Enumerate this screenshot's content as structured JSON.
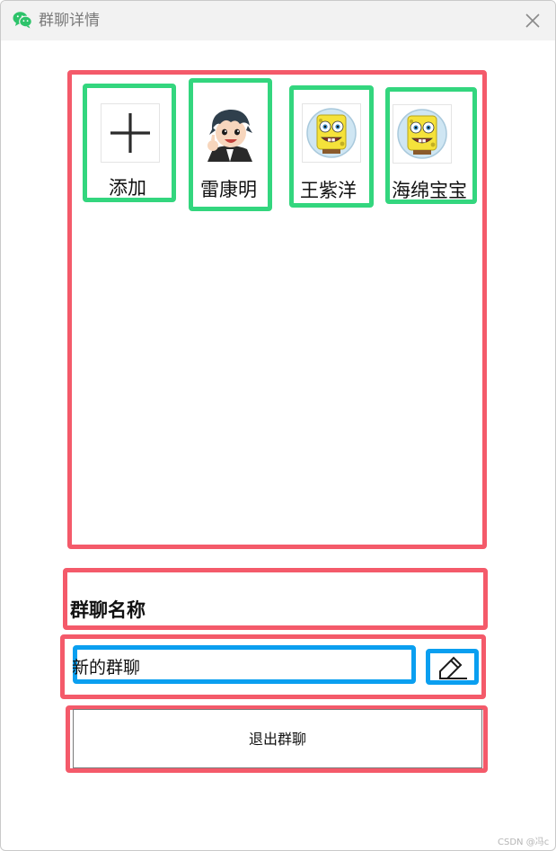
{
  "window": {
    "title": "群聊详情",
    "title_icon": "wechat-logo-icon",
    "close_icon": "close-icon"
  },
  "members": {
    "items": [
      {
        "label": "添加",
        "avatar": "plus-icon"
      },
      {
        "label": "雷康明",
        "avatar": "cartoon-boy-avatar"
      },
      {
        "label": "王紫洋",
        "avatar": "spongebob-avatar"
      },
      {
        "label": "海绵宝宝",
        "avatar": "spongebob-avatar"
      }
    ]
  },
  "group_name": {
    "heading": "群聊名称",
    "value": "新的群聊",
    "edit_icon": "pencil-icon"
  },
  "actions": {
    "leave_label": "退出群聊"
  },
  "watermark": "CSDN @冯c",
  "colors": {
    "red_box": "#f45a6a",
    "green_box": "#33d67e",
    "blue_box": "#0a9ff0",
    "titlebar": "#f2f2f2"
  }
}
